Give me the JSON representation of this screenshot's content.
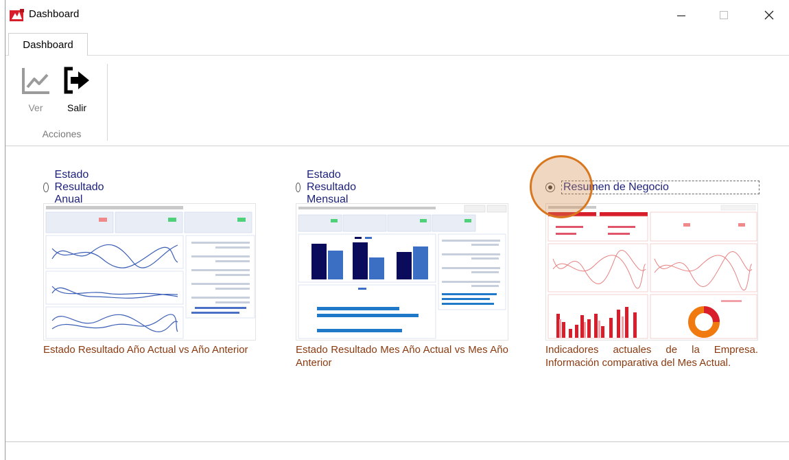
{
  "window": {
    "title": "Dashboard",
    "icon": "app-logo-icon",
    "controls": [
      "minimize-icon",
      "maximize-icon",
      "close-icon"
    ]
  },
  "tabs": [
    {
      "label": "Dashboard",
      "active": true
    }
  ],
  "ribbon": {
    "buttons": [
      {
        "label": "Ver",
        "icon": "line-chart-icon",
        "enabled": false
      },
      {
        "label": "Salir",
        "icon": "exit-icon",
        "enabled": true
      }
    ],
    "group_label": "Acciones"
  },
  "options": [
    {
      "label": "Estado Resultado Anual",
      "selected": false,
      "description": "Estado Resultado Año Actual vs Año Anterior",
      "thumbnail": "line-charts-thumbnail"
    },
    {
      "label": "Estado Resultado Mensual",
      "selected": false,
      "description": "Estado Resultado Mes Año Actual vs Mes Año Anterior",
      "thumbnail": "bar-charts-thumbnail"
    },
    {
      "label": "Resumen de Negocio",
      "selected": true,
      "description": "Indicadores actuales de la Empresa. Información comparativa del Mes Actual.",
      "thumbnail": "business-summary-thumbnail"
    }
  ],
  "colors": {
    "option_label": "#1b1f7a",
    "description": "#8b3a10",
    "accent_red": "#d81e2a",
    "navy": "#0b0b5c",
    "blue": "#3a6fc4",
    "cursor": "#d9771f"
  }
}
